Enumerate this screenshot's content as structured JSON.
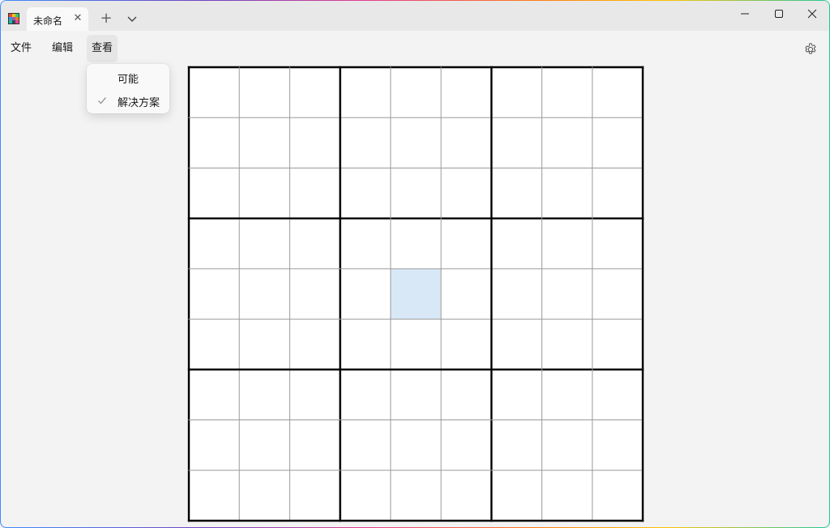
{
  "titlebar": {
    "app_icon": "sudoku-grid-icon",
    "tab_title": "未命名",
    "tab_close_icon": "close-icon",
    "new_tab_icon": "plus-icon",
    "tab_list_icon": "chevron-down-icon",
    "window_controls": [
      "minimize-icon",
      "maximize-icon",
      "close-icon"
    ]
  },
  "menu": {
    "file": "文件",
    "edit": "编辑",
    "view": "查看",
    "settings_icon": "gear-icon"
  },
  "view_menu": {
    "items": [
      {
        "label": "可能",
        "checked": false
      },
      {
        "label": "解决方案",
        "checked": true
      }
    ]
  },
  "board": {
    "size": 9,
    "box": 3,
    "selected_cell": {
      "row": 4,
      "col": 4
    },
    "cells": [
      [
        "",
        "",
        "",
        "",
        "",
        "",
        "",
        "",
        ""
      ],
      [
        "",
        "",
        "",
        "",
        "",
        "",
        "",
        "",
        ""
      ],
      [
        "",
        "",
        "",
        "",
        "",
        "",
        "",
        "",
        ""
      ],
      [
        "",
        "",
        "",
        "",
        "",
        "",
        "",
        "",
        ""
      ],
      [
        "",
        "",
        "",
        "",
        "",
        "",
        "",
        "",
        ""
      ],
      [
        "",
        "",
        "",
        "",
        "",
        "",
        "",
        "",
        ""
      ],
      [
        "",
        "",
        "",
        "",
        "",
        "",
        "",
        "",
        ""
      ],
      [
        "",
        "",
        "",
        "",
        "",
        "",
        "",
        "",
        ""
      ],
      [
        "",
        "",
        "",
        "",
        "",
        "",
        "",
        "",
        ""
      ]
    ]
  },
  "colors": {
    "selected_cell": "#d9e8f7",
    "thin_line": "#9a9a9a",
    "thick_line": "#000000",
    "window_bg": "#f3f3f3"
  }
}
